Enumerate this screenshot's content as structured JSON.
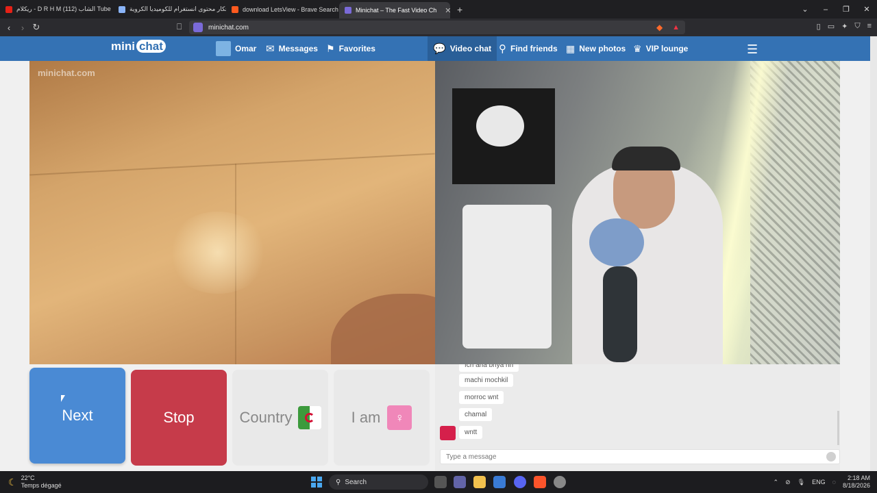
{
  "browser": {
    "tabs": [
      {
        "title": "ريكلام - D R H M الشاب (112) Tube",
        "icon_color": "#e62117"
      },
      {
        "title": "أفكار محتوى انستغرام للكوميديا الكروية",
        "icon_color": "#8ab4f8"
      },
      {
        "title": "download LetsView - Brave Search",
        "icon_color": "#ff5a1f"
      },
      {
        "title": "Minichat – The Fast Video Ch",
        "icon_color": "#7a6ad8"
      }
    ],
    "new_tab": "+",
    "url": "minichat.com"
  },
  "header": {
    "logo_mini": "mini",
    "logo_chat": "chat",
    "user": "Omar",
    "messages": "Messages",
    "favorites": "Favorites",
    "video_chat": "Video chat",
    "find_friends": "Find friends",
    "new_photos": "New photos",
    "vip_lounge": "VIP lounge"
  },
  "video": {
    "watermark_mini": "mini",
    "watermark_chat": "chat",
    "watermark_domain": ".com"
  },
  "controls": {
    "next": "Next",
    "stop": "Stop",
    "country": "Country",
    "iam": "I am"
  },
  "chat": {
    "messages": [
      "fch ana briya nn",
      "machi mochkil",
      "morroc wnt",
      "chamal",
      "wntt"
    ],
    "placeholder": "Type a message"
  },
  "taskbar": {
    "temp": "22°C",
    "weather": "Temps dégagé",
    "search": "Search",
    "lang": "ENG",
    "time": "2:18 AM",
    "date": "8/18/2026"
  },
  "colors": {
    "header_blue": "#3472b4",
    "next_blue": "#4a8ad4",
    "stop_red": "#c63b4a"
  }
}
